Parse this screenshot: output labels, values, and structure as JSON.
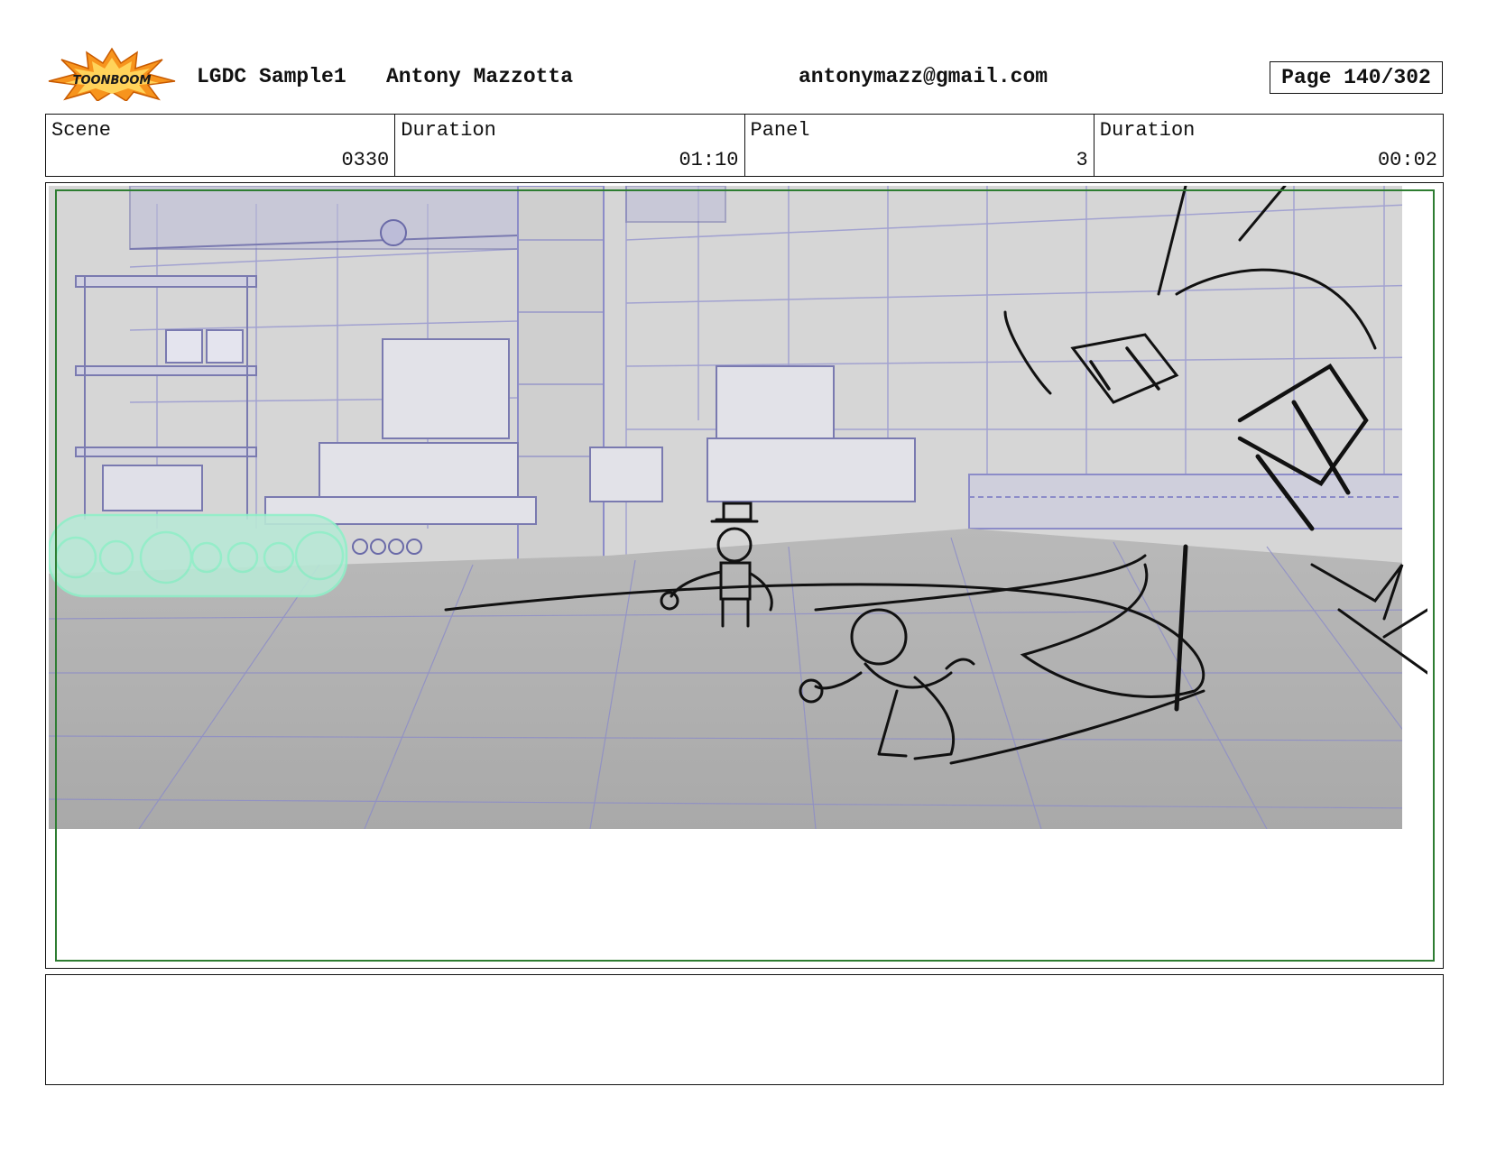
{
  "header": {
    "logo_text": "TOONBOOM",
    "project": "LGDC Sample1",
    "author": "Antony Mazzotta",
    "email": "antonymazz@gmail.com",
    "page": "Page 140/302"
  },
  "info": {
    "scene_label": "Scene",
    "scene_value": "0330",
    "scene_duration_label": "Duration",
    "scene_duration_value": "01:10",
    "panel_label": "Panel",
    "panel_value": "3",
    "panel_duration_label": "Duration",
    "panel_duration_value": "00:02"
  },
  "colors": {
    "safe_frame": "#2e7d32",
    "background_lines": "#8c8cc8",
    "conveyor_highlight": "#8ff0c8",
    "sketch_ink": "#111111"
  },
  "notes": {
    "text": ""
  }
}
